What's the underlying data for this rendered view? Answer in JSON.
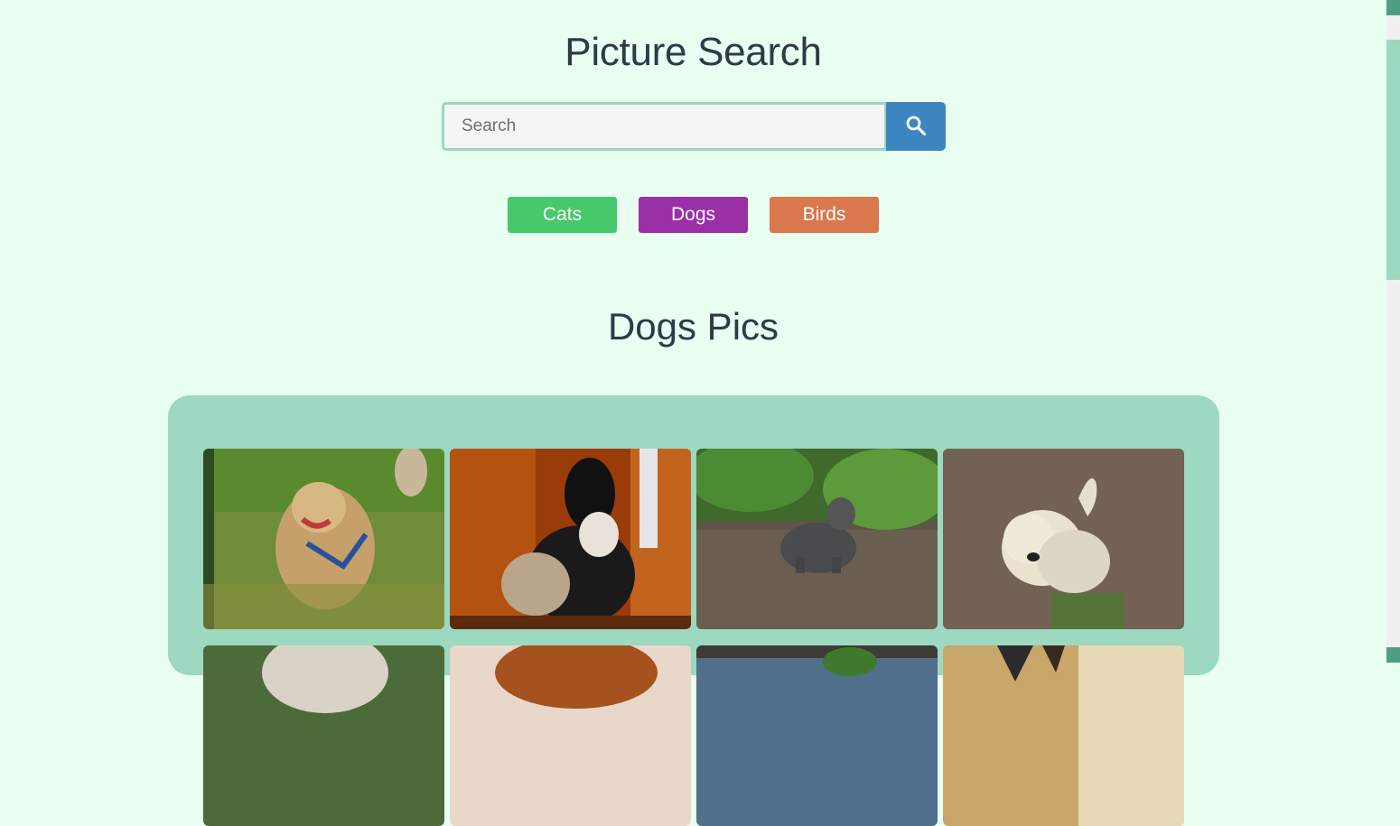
{
  "page": {
    "title": "Picture Search",
    "section_title": "Dogs Pics"
  },
  "search": {
    "placeholder": "Search",
    "value": "",
    "button_icon": "search-icon"
  },
  "categories": [
    {
      "label": "Cats",
      "color": "#47c86c"
    },
    {
      "label": "Dogs",
      "color": "#9a2fa6"
    },
    {
      "label": "Birds",
      "color": "#d8784c"
    }
  ],
  "colors": {
    "background": "#e8fff2",
    "gallery_panel": "#9dd8c0",
    "search_button": "#3e86c0"
  },
  "gallery": {
    "photos": [
      {
        "subject": "small tan terrier running on grass with blue harness"
      },
      {
        "subject": "black and white dog looking out a wooden door"
      },
      {
        "subject": "grey terrier standing on forest path"
      },
      {
        "subject": "white cairn terrier on leafy ground"
      },
      {
        "subject": "dog (partially visible)"
      },
      {
        "subject": "red-haired dog (partially visible)"
      },
      {
        "subject": "dog outdoors near building (partially visible)"
      },
      {
        "subject": "dog with pointed ears (partially visible)"
      }
    ]
  }
}
